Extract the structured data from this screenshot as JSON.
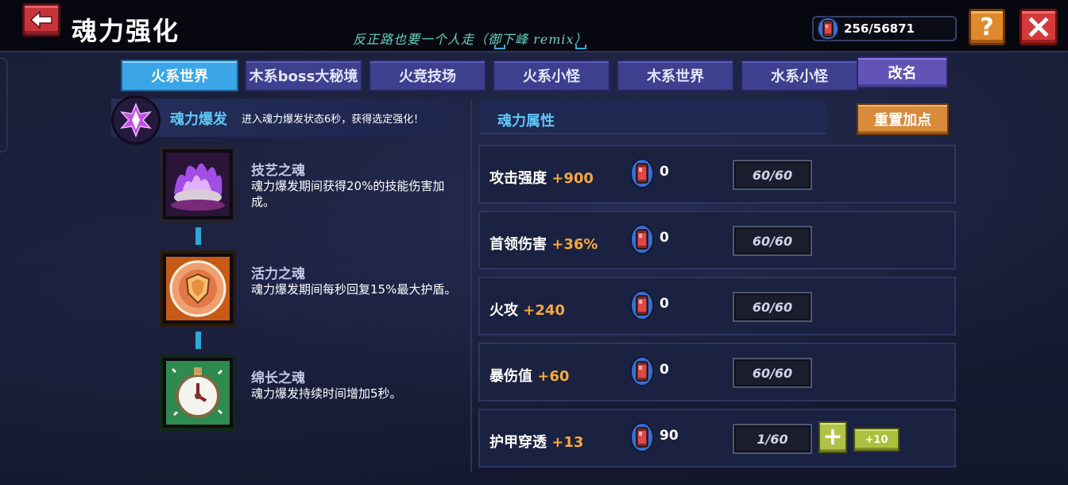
{
  "header": {
    "title": "魂力强化",
    "song": "反正路也要一个人走（御下峰 remix）",
    "currency": "256/56871",
    "help_label": "?"
  },
  "tabs": [
    {
      "label": "火系世界",
      "active": true
    },
    {
      "label": "木系boss大秘境",
      "active": false
    },
    {
      "label": "火竞技场",
      "active": false
    },
    {
      "label": "火系小怪",
      "active": false
    },
    {
      "label": "木系世界",
      "active": false
    },
    {
      "label": "水系小怪",
      "active": false
    }
  ],
  "rename_label": "改名",
  "burst": {
    "title": "魂力爆发",
    "desc": "进入魂力爆发状态6秒，获得选定强化！"
  },
  "souls": [
    {
      "name": "技艺之魂",
      "desc": "魂力爆发期间获得20%的技能伤害加成。",
      "icon": "purple-flame-icon"
    },
    {
      "name": "活力之魂",
      "desc": "魂力爆发期间每秒回复15%最大护盾。",
      "icon": "shield-icon"
    },
    {
      "name": "绵长之魂",
      "desc": "魂力爆发持续时间增加5秒。",
      "icon": "stopwatch-icon"
    }
  ],
  "attributes": {
    "title": "魂力属性",
    "reset_label": "重置加点",
    "rows": [
      {
        "name": "攻击强度",
        "bonus": "+900",
        "count": "0",
        "level": "60/60",
        "show_plus": false
      },
      {
        "name": "首领伤害",
        "bonus": "+36%",
        "count": "0",
        "level": "60/60",
        "show_plus": false
      },
      {
        "name": "火攻",
        "bonus": "+240",
        "count": "0",
        "level": "60/60",
        "show_plus": false
      },
      {
        "name": "暴伤值",
        "bonus": "+60",
        "count": "0",
        "level": "60/60",
        "show_plus": false
      },
      {
        "name": "护甲穿透",
        "bonus": "+13",
        "count": "90",
        "level": "1/60",
        "show_plus": true
      }
    ],
    "plus_label": "+",
    "plus10_label": "+10"
  }
}
